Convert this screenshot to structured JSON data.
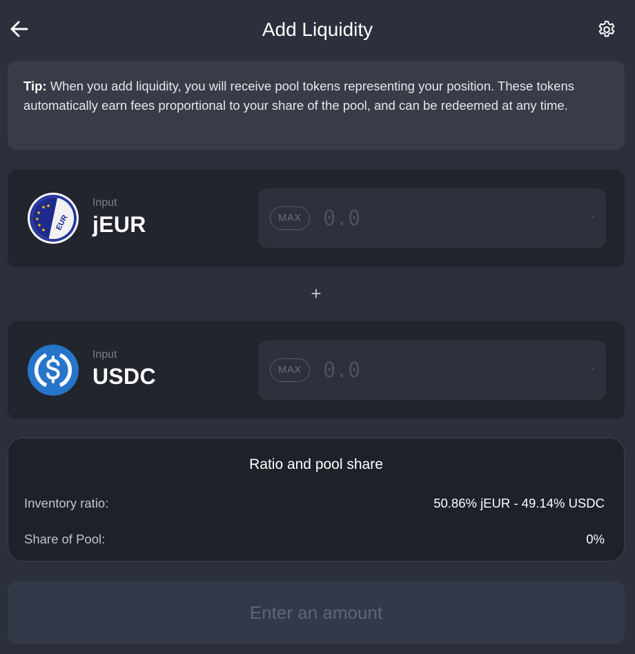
{
  "header": {
    "title": "Add Liquidity",
    "back_icon": "arrow-left-icon",
    "settings_icon": "gear-icon"
  },
  "tip": {
    "prefix": "Tip:",
    "text": "When you add liquidity, you will receive pool tokens representing your position. These tokens automatically earn fees proportional to your share of the pool, and can be redeemed at any time."
  },
  "inputs": [
    {
      "label": "Input",
      "token": "jEUR",
      "logo_text": "EUR",
      "logo_icon": "euro-flag-coin-icon",
      "max_label": "MAX",
      "placeholder": "0.0",
      "value": "",
      "suffix": "-"
    },
    {
      "label": "Input",
      "token": "USDC",
      "logo_icon": "usdc-coin-icon",
      "max_label": "MAX",
      "placeholder": "0.0",
      "value": "",
      "suffix": "-"
    }
  ],
  "plus_symbol": "+",
  "ratio": {
    "title": "Ratio and pool share",
    "rows": [
      {
        "label": "Inventory ratio:",
        "value": "50.86% jEUR - 49.14% USDC"
      },
      {
        "label": "Share of Pool:",
        "value": "0%"
      }
    ]
  },
  "submit": {
    "label": "Enter an amount",
    "disabled": true
  },
  "colors": {
    "background": "#2c303c",
    "card": "#22252e",
    "tip_card": "#383c48",
    "ratio_card": "#1e202a",
    "button_disabled": "#323a4a",
    "usdc_blue": "#2775ca",
    "eur_navy": "#1f2b8c",
    "eur_star": "#f2c200"
  }
}
